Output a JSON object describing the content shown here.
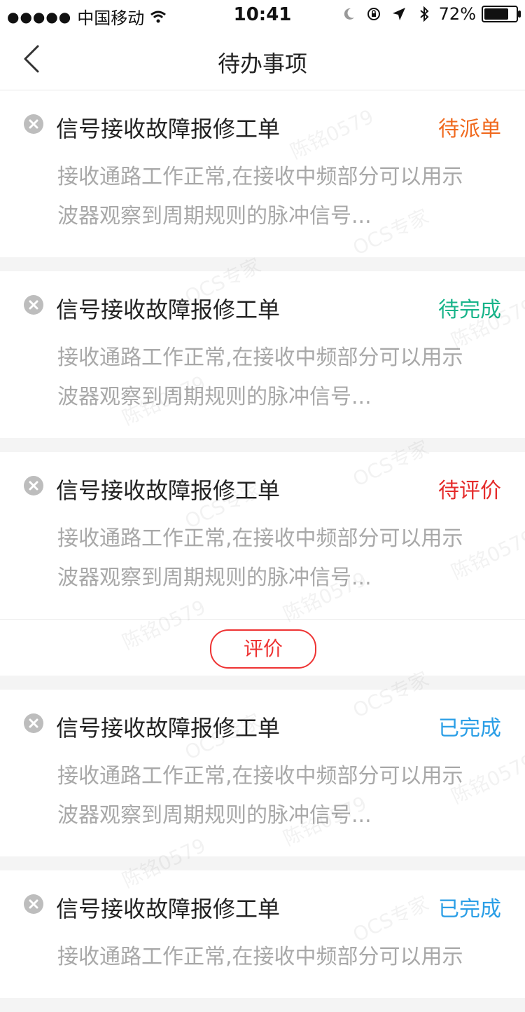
{
  "status_bar": {
    "carrier": "中国移动",
    "time": "10:41",
    "battery": "72%"
  },
  "nav": {
    "title": "待办事项"
  },
  "cards": [
    {
      "title": "信号接收故障报修工单",
      "status": "待派单",
      "status_color": "#f06a1f",
      "desc_line1": "接收通路工作正常,在接收中频部分可以用示",
      "desc_line2": "波器观察到周期规则的脉冲信号..."
    },
    {
      "title": "信号接收故障报修工单",
      "status": "待完成",
      "status_color": "#18b48a",
      "desc_line1": "接收通路工作正常,在接收中频部分可以用示",
      "desc_line2": "波器观察到周期规则的脉冲信号..."
    },
    {
      "title": "信号接收故障报修工单",
      "status": "待评价",
      "status_color": "#e52b2b",
      "desc_line1": "接收通路工作正常,在接收中频部分可以用示",
      "desc_line2": "波器观察到周期规则的脉冲信号...",
      "action_label": "评价"
    },
    {
      "title": "信号接收故障报修工单",
      "status": "已完成",
      "status_color": "#2a9ee6",
      "desc_line1": "接收通路工作正常,在接收中频部分可以用示",
      "desc_line2": "波器观察到周期规则的脉冲信号..."
    },
    {
      "title": "信号接收故障报修工单",
      "status": "已完成",
      "status_color": "#2a9ee6",
      "desc_line1": "接收通路工作正常,在接收中频部分可以用示"
    }
  ],
  "watermarks": {
    "user": "陈铭0579",
    "brand": "OCS专家"
  }
}
